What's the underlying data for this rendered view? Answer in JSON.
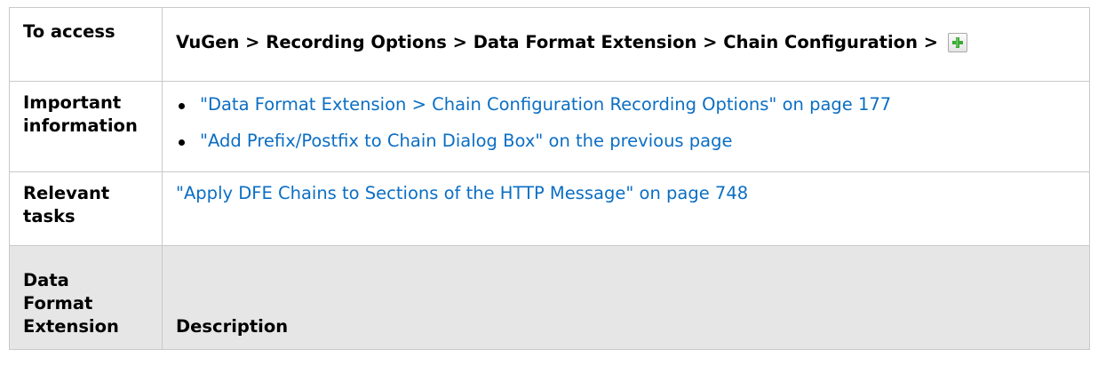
{
  "rows": {
    "access": {
      "label": "To access",
      "path": "VuGen > Recording Options > Data Format Extension > Chain Configuration > "
    },
    "important": {
      "label_line1": "Important",
      "label_line2": "information",
      "links": [
        "\"Data Format Extension > Chain Configuration Recording Options\" on page 177",
        "\"Add Prefix/Postfix to Chain Dialog Box\" on the previous page"
      ]
    },
    "tasks": {
      "label_line1": "Relevant",
      "label_line2": "tasks",
      "link": "\"Apply DFE Chains to Sections of the HTTP Message\" on page 748"
    }
  },
  "header": {
    "col1_line1": "Data",
    "col1_line2": "Format",
    "col1_line3": "Extension",
    "col2": "Description"
  },
  "icons": {
    "add": "plus-icon"
  },
  "colors": {
    "link": "#0b6ec3",
    "header_bg": "#e6e6e6",
    "border": "#c9c9c9",
    "plus": "#3aa935"
  }
}
